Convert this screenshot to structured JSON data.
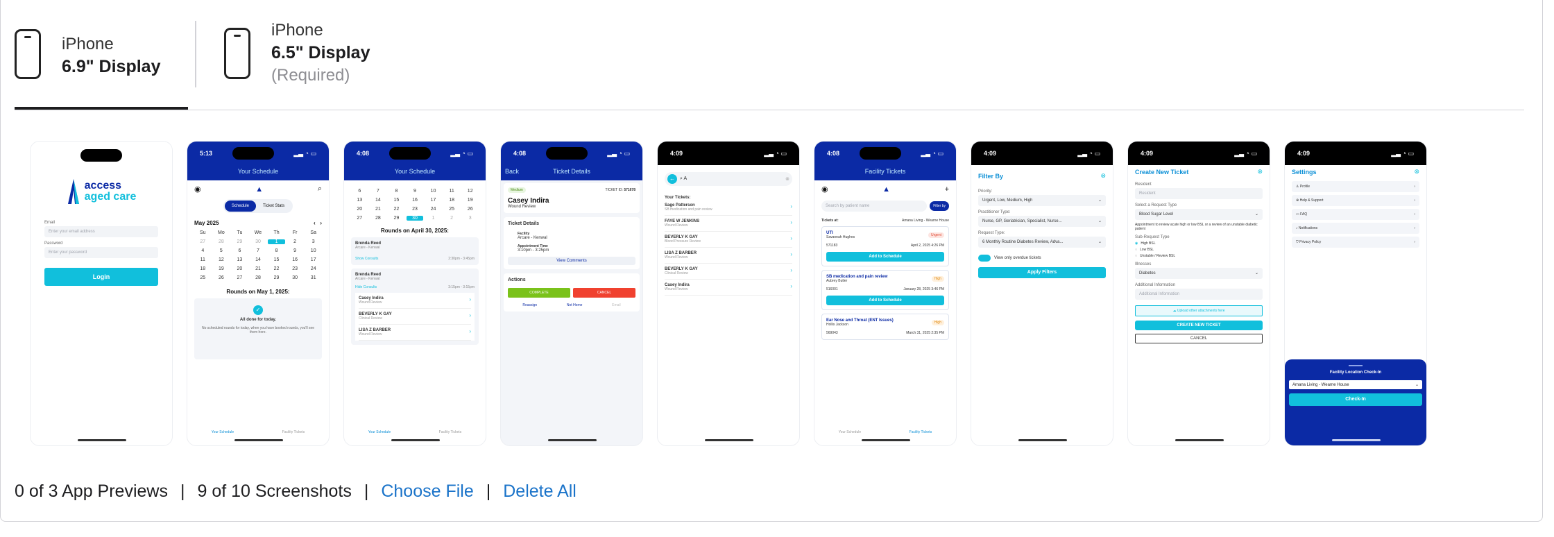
{
  "tabs": [
    {
      "line1": "iPhone",
      "line2": "6.9\" Display",
      "line3": ""
    },
    {
      "line1": "iPhone",
      "line2": "6.5\" Display",
      "line3": "(Required)"
    }
  ],
  "footer": {
    "previews": "0 of 3 App Previews",
    "screenshots": "9 of 10 Screenshots",
    "choose": "Choose File",
    "delete": "Delete All"
  },
  "s1": {
    "brand1": "access",
    "brand2": "aged care",
    "email": "Email",
    "email_ph": "Enter your email address",
    "password": "Password",
    "password_ph": "Enter your password",
    "login": "Login"
  },
  "s2": {
    "time": "5:13",
    "header": "Your Schedule",
    "tab_a": "Schedule",
    "tab_b": "Ticket Stats",
    "month": "May 2025",
    "days": [
      "Su",
      "Mo",
      "Tu",
      "We",
      "Th",
      "Fr",
      "Sa"
    ],
    "dates": [
      "27",
      "28",
      "29",
      "30",
      "1",
      "2",
      "3",
      "4",
      "5",
      "6",
      "7",
      "8",
      "9",
      "10",
      "11",
      "12",
      "13",
      "14",
      "15",
      "16",
      "17",
      "18",
      "19",
      "20",
      "21",
      "22",
      "23",
      "24",
      "25",
      "26",
      "27",
      "28",
      "29",
      "30",
      "31"
    ],
    "rounds": "Rounds on May 1, 2025:",
    "done": "All done for today.",
    "done_sub": "No scheduled rounds for today, when you have booked rounds, you'll see them here.",
    "nav_a": "Your Schedule",
    "nav_b": "Facility Tickets"
  },
  "s3": {
    "time": "4:08",
    "header": "Your Schedule",
    "dates": [
      "6",
      "7",
      "8",
      "9",
      "10",
      "11",
      "12",
      "13",
      "14",
      "15",
      "16",
      "17",
      "18",
      "19",
      "20",
      "21",
      "22",
      "23",
      "24",
      "25",
      "26",
      "27",
      "28",
      "29",
      "30",
      "1",
      "2",
      "3"
    ],
    "rounds": "Rounds on April 30, 2025:",
    "name1": "Brenda Reed",
    "place1": "Arcare - Kenwal",
    "show": "Show Consults",
    "time1": "2:30pm - 3:45pm",
    "name2": "Brenda Reed",
    "place2": "Arcare - Kenwal",
    "hide": "Hide Consults",
    "time2": "3:15pm - 3:15pm",
    "consults": [
      {
        "n": "Casey Indira",
        "r": "Wound Review"
      },
      {
        "n": "BEVERLY K GAY",
        "r": "Clinical Review"
      },
      {
        "n": "LISA Z BARBER",
        "r": "Wound Review"
      }
    ],
    "nav_a": "Your Schedule",
    "nav_b": "Facility Tickets"
  },
  "s4": {
    "time": "4:08",
    "back": "Back",
    "header": "Ticket Details",
    "priority": "Medium",
    "ticket_label": "TICKET ID:",
    "ticket_id": "571678",
    "name": "Casey Indira",
    "reason": "Wound Review",
    "section": "Ticket Details",
    "facility_l": "Facility",
    "facility": "Arcare - Kenwal",
    "appt_l": "Appointment Time",
    "appt": "3:10pm - 3:25pm",
    "comments": "View Comments",
    "actions": "Actions",
    "complete": "COMPLETE",
    "cancel": "CANCEL",
    "a1": "Reassign",
    "a2": "Not Home",
    "a3": "Email"
  },
  "s5": {
    "time": "4:09",
    "search": "A",
    "yours": "Your Tickets:",
    "tickets": [
      {
        "n": "Sage Patterson",
        "r": "SB medication and pain review"
      },
      {
        "n": "FAYE W JENKINS",
        "r": "Wound Review"
      },
      {
        "n": "BEVERLY K GAY",
        "r": "Blood Pressure Review"
      },
      {
        "n": "LISA Z BARBER",
        "r": "Wound Review"
      },
      {
        "n": "BEVERLY K GAY",
        "r": "Clinical Review"
      },
      {
        "n": "Casey Indira",
        "r": "Wound Review"
      }
    ]
  },
  "s6": {
    "time": "4:08",
    "header": "Facility Tickets",
    "search_ph": "Search by patient name",
    "filter": "Filter by",
    "at": "Tickets at:",
    "facility": "Amana Living - Wearne House",
    "cards": [
      {
        "t": "UTI",
        "p": "Savannah Hughes",
        "badge": "Urgent",
        "id": "571183",
        "date": "April 2, 2025 4:26 PM",
        "btn": "Add to Schedule"
      },
      {
        "t": "SB medication and pain review",
        "p": "Aubrey Butler",
        "badge": "High",
        "id": "516001",
        "date": "January 28, 2025 3:46 PM",
        "btn": "Add to Schedule"
      },
      {
        "t": "Ear Nose and Throat (ENT Issues)",
        "p": "Hollis Jackson",
        "badge": "High",
        "id": "569043",
        "date": "March 31, 2025 2:35 PM",
        "btn": ""
      }
    ],
    "nav_a": "Your Schedule",
    "nav_b": "Facility Tickets"
  },
  "s7": {
    "time": "4:09",
    "title": "Filter By",
    "priority_l": "Priority:",
    "priority": "Urgent, Low, Medium, High",
    "ptype_l": "Practitioner Type:",
    "ptype": "Nurse, GP, Geriatrician, Specialist, Nurse...",
    "rtype_l": "Request Type:",
    "rtype": "6 Monthly Routine Diabetes Review, Adva...",
    "overdue": "View only overdue tickets",
    "apply": "Apply Filters"
  },
  "s8": {
    "time": "4:09",
    "title": "Create New Ticket",
    "resident_l": "Resident",
    "resident_ph": "Resident",
    "req_l": "Select a Request Type",
    "req": "Blood Sugar Level",
    "desc": "Appointment to review acute high or low BSL or a review of an unstable diabetic patient",
    "sub_l": "Sub-Request Type",
    "opts": [
      "High BSL",
      "Low BSL",
      "Unstable / Review BSL"
    ],
    "illness_l": "Illnesses",
    "illness": "Diabetes",
    "info_l": "Additional Information",
    "info_ph": "Additional Information",
    "upload": "Upload other attachments here",
    "create": "CREATE NEW TICKET",
    "cancel": "CANCEL"
  },
  "s9": {
    "time": "4:09",
    "title": "Settings",
    "items": [
      "Profile",
      "Help & Support",
      "FAQ",
      "Notifications",
      "Privacy Policy"
    ],
    "checkin_title": "Facility Location Check-In",
    "checkin_value": "Amana Living - Wearne House",
    "checkin_btn": "Check-In"
  },
  "colors": {
    "brand_blue": "#0b2aa5",
    "cyan": "#11bfdc",
    "link": "#1a73c9",
    "green": "#7ac21a",
    "red": "#f0412f"
  }
}
